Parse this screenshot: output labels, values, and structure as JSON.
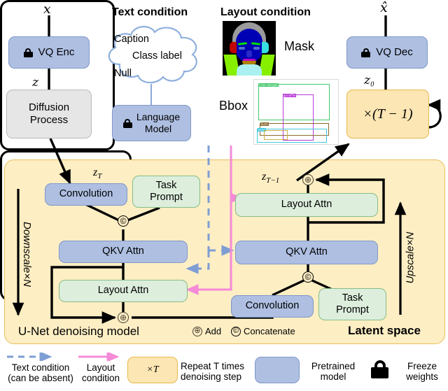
{
  "pipeline": {
    "input_symbol": "𝑥",
    "output_symbol": "𝑥̂",
    "latent_in": "𝑧",
    "latent_out": "𝑧₀",
    "vq_enc": "VQ Enc",
    "vq_dec": "VQ Dec",
    "diffusion_process": "Diffusion\nProcess",
    "diffusion_line1": "Diffusion",
    "diffusion_line2": "Process",
    "repeat_box": "×(T − 1)"
  },
  "text_condition": {
    "title": "Text condition",
    "cloud_items": [
      "Caption",
      "Class label",
      "Null"
    ],
    "language_model_line1": "Language",
    "language_model_line2": "Model"
  },
  "layout_condition": {
    "title": "Layout condition",
    "mask_label": "Mask",
    "bbox_label": "Bbox",
    "bbox_tags": [
      "tree-merged",
      "giraffe",
      "bush",
      "wood"
    ]
  },
  "unet": {
    "zt_label": "z_T",
    "ztm1_label": "z_{T−1}",
    "downscale_label": "Downscale×N",
    "upscale_label": "Upscale×N",
    "footer_title": "U-Net denoising model",
    "add_symbol": "⊕",
    "add_label": "Add",
    "concat_symbol": "©",
    "concat_label": "Concatenate",
    "latent_space_label": "Latent space",
    "left_branch": [
      {
        "name": "Convolution",
        "kind": "blue"
      },
      {
        "name": "Task Prompt",
        "kind": "green"
      },
      {
        "name": "QKV Attn",
        "kind": "blue"
      },
      {
        "name": "Layout Attn",
        "kind": "green"
      }
    ],
    "right_branch": [
      {
        "name": "Layout Attn",
        "kind": "green"
      },
      {
        "name": "QKV Attn",
        "kind": "blue"
      },
      {
        "name": "Convolution",
        "kind": "blue"
      },
      {
        "name": "Task Prompt",
        "kind": "green"
      }
    ]
  },
  "legend": {
    "text_condition_line1": "Text condition",
    "text_condition_line2": "(can be absent)",
    "layout_condition_line1": "Layout",
    "layout_condition_line2": "condition",
    "repeat_box_label": "×T",
    "repeat_line1": "Repeat T times",
    "repeat_line2": "denoising step",
    "pretrained_line1": "Pretrained",
    "pretrained_line2": "model",
    "freeze_line1": "Freeze",
    "freeze_line2": "weights"
  },
  "colors": {
    "blue_fill": "#aebfe2",
    "blue_border": "#7f97c8",
    "green_fill": "#ddeedd",
    "green_border": "#86bd86",
    "grey_fill": "#e6e6e6",
    "yellow_fill": "#fdeec4",
    "yellow_border": "#e9bf5c",
    "repeat_fill": "#fce6b4",
    "repeat_border": "#e8b84b",
    "text_arrow": "#7e9ed4",
    "layout_arrow": "#f58ad8"
  }
}
